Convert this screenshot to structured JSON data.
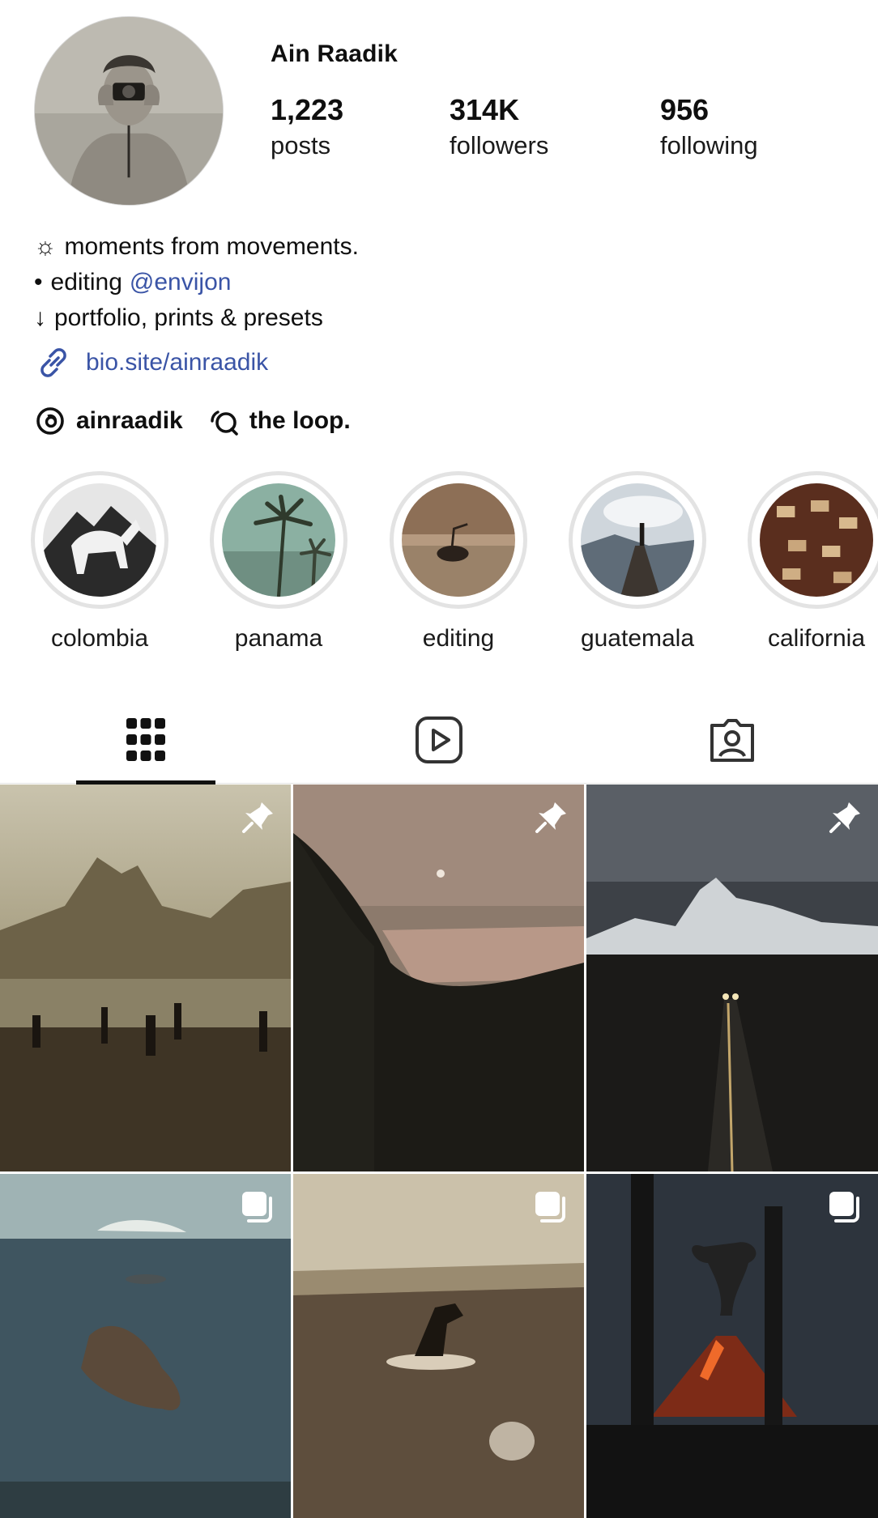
{
  "profile": {
    "name": "Ain Raadik",
    "avatar_icon": "profile-photo-photographer-with-camera",
    "stats": [
      {
        "value": "1,223",
        "label": "posts"
      },
      {
        "value": "314K",
        "label": "followers"
      },
      {
        "value": "956",
        "label": "following"
      }
    ]
  },
  "bio": {
    "line1_prefix": "☼",
    "line1_text": "moments from movements.",
    "line2_prefix": "•",
    "line2_text": "editing",
    "line2_mention": "@envijon",
    "line3_prefix": "↓",
    "line3_text": "portfolio, prints & presets",
    "link_icon": "link-icon",
    "link": "bio.site/ainraadik",
    "threads_handle": "ainraadik",
    "channel_name": "the loop."
  },
  "highlights": [
    {
      "label": "colombia",
      "icon": "horse-mountain-thumb"
    },
    {
      "label": "panama",
      "icon": "palm-trees-thumb"
    },
    {
      "label": "editing",
      "icon": "rock-sea-thumb"
    },
    {
      "label": "guatemala",
      "icon": "dock-volcano-thumb"
    },
    {
      "label": "california",
      "icon": "aerial-cars-thumb"
    }
  ],
  "tabs": [
    {
      "name": "posts",
      "icon": "grid-icon",
      "active": true
    },
    {
      "name": "reels",
      "icon": "reels-icon",
      "active": false
    },
    {
      "name": "tagged",
      "icon": "tagged-person-icon",
      "active": false
    }
  ],
  "grid": [
    {
      "scene": "beach-mountain-sunset",
      "badge": "pin-icon"
    },
    {
      "scene": "jungle-moon-lagoon",
      "badge": "pin-icon"
    },
    {
      "scene": "night-road-mountains",
      "badge": "pin-icon"
    },
    {
      "scene": "aerial-island-sea",
      "badge": "carousel-icon"
    },
    {
      "scene": "skimboarder-shore",
      "badge": "carousel-icon"
    },
    {
      "scene": "erupting-volcano-night",
      "badge": "carousel-icon"
    }
  ],
  "colors": {
    "link_blue": "#3a54a6",
    "ring_gray": "#e3e3e3",
    "tab_active": "#111111"
  }
}
